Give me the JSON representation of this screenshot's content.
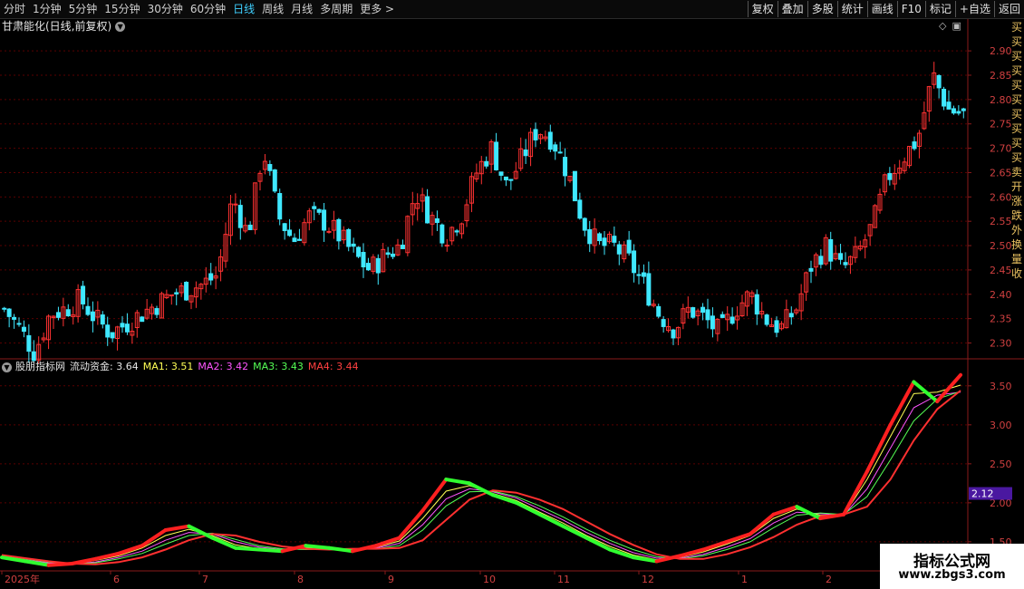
{
  "toolbar": {
    "periods": [
      "分时",
      "1分钟",
      "5分钟",
      "15分钟",
      "30分钟",
      "60分钟",
      "日线",
      "周线",
      "月线",
      "多周期",
      "更多 >"
    ],
    "active_period": "日线",
    "tools": [
      "复权",
      "叠加",
      "多股",
      "统计",
      "画线",
      "F10",
      "标记",
      "+自选",
      "返回"
    ]
  },
  "main_chart": {
    "title": "甘肃能化(日线,前复权)",
    "price_axis": [
      "2.90",
      "2.85",
      "2.80",
      "2.75",
      "2.70",
      "2.65",
      "2.60",
      "2.55",
      "2.50",
      "2.45",
      "2.40",
      "2.35",
      "2.30"
    ],
    "colors": {
      "up": "#ff3232",
      "down": "#3fe8ff",
      "grid": "#5a0000",
      "axis": "#8a1a1a",
      "label": "#d04040"
    }
  },
  "indicator": {
    "name": "股朋指标网",
    "fields": [
      {
        "label": "流动资金:",
        "value": "3.64",
        "color": "#e6e6e6"
      },
      {
        "label": "MA1:",
        "value": "3.51",
        "color": "#ffff55"
      },
      {
        "label": "MA2:",
        "value": "3.42",
        "color": "#ff55ff"
      },
      {
        "label": "MA3:",
        "value": "3.43",
        "color": "#55ff55"
      },
      {
        "label": "MA4:",
        "value": "3.44",
        "color": "#ff4040"
      }
    ],
    "axis": [
      "3.50",
      "3.00",
      "2.50",
      "2.00",
      "1.50"
    ],
    "marker_value": "2.12"
  },
  "date_axis": [
    "2025年",
    "6",
    "7",
    "8",
    "9",
    "10",
    "11",
    "12",
    "1",
    "2"
  ],
  "right_strip_text": "买买买买买买买买买买卖开涨跌外换量收",
  "watermark": {
    "line1": "指标公式网",
    "line2": "www.zbgs3.com"
  },
  "chart_data": {
    "type": "candlestick",
    "title": "甘肃能化(日线,前复权)",
    "ylim": [
      2.26,
      2.93
    ],
    "y_ticks": [
      2.9,
      2.85,
      2.8,
      2.75,
      2.7,
      2.65,
      2.6,
      2.55,
      2.5,
      2.45,
      2.4,
      2.35,
      2.3
    ],
    "months": [
      "2025年",
      "6",
      "7",
      "8",
      "9",
      "10",
      "11",
      "12",
      "1",
      "2"
    ],
    "close_path": [
      2.37,
      2.33,
      2.28,
      2.36,
      2.37,
      2.39,
      2.35,
      2.32,
      2.34,
      2.36,
      2.38,
      2.4,
      2.41,
      2.42,
      2.44,
      2.6,
      2.52,
      2.7,
      2.56,
      2.51,
      2.56,
      2.55,
      2.52,
      2.48,
      2.45,
      2.48,
      2.5,
      2.61,
      2.56,
      2.52,
      2.56,
      2.65,
      2.7,
      2.62,
      2.68,
      2.74,
      2.72,
      2.65,
      2.55,
      2.5,
      2.5,
      2.47,
      2.42,
      2.36,
      2.33,
      2.37,
      2.35,
      2.32,
      2.37,
      2.4,
      2.35,
      2.33,
      2.37,
      2.46,
      2.5,
      2.45,
      2.48,
      2.54,
      2.64,
      2.68,
      2.72,
      2.85,
      2.78,
      2.77
    ],
    "indicator": {
      "ylim": [
        1.15,
        3.8
      ],
      "series": [
        {
          "name": "流动资金",
          "values": [
            1.3,
            1.25,
            1.2,
            1.22,
            1.28,
            1.35,
            1.45,
            1.65,
            1.7,
            1.55,
            1.42,
            1.4,
            1.38,
            1.45,
            1.42,
            1.38,
            1.45,
            1.55,
            1.9,
            2.3,
            2.25,
            2.1,
            2.0,
            1.85,
            1.7,
            1.55,
            1.4,
            1.3,
            1.25,
            1.32,
            1.4,
            1.5,
            1.6,
            1.85,
            1.95,
            1.8,
            1.85,
            2.4,
            3.0,
            3.55,
            3.3,
            3.64
          ]
        },
        {
          "name": "MA1",
          "values": [
            1.3,
            1.26,
            1.22,
            1.22,
            1.26,
            1.32,
            1.42,
            1.58,
            1.66,
            1.58,
            1.46,
            1.41,
            1.39,
            1.42,
            1.42,
            1.4,
            1.43,
            1.51,
            1.8,
            2.15,
            2.22,
            2.12,
            2.03,
            1.88,
            1.74,
            1.58,
            1.44,
            1.33,
            1.27,
            1.3,
            1.37,
            1.47,
            1.58,
            1.8,
            1.92,
            1.84,
            1.84,
            2.3,
            2.85,
            3.4,
            3.42,
            3.51
          ]
        },
        {
          "name": "MA2",
          "values": [
            1.31,
            1.27,
            1.23,
            1.22,
            1.24,
            1.3,
            1.38,
            1.52,
            1.62,
            1.6,
            1.5,
            1.43,
            1.4,
            1.41,
            1.41,
            1.4,
            1.42,
            1.48,
            1.72,
            2.05,
            2.18,
            2.14,
            2.06,
            1.92,
            1.78,
            1.62,
            1.48,
            1.36,
            1.29,
            1.29,
            1.34,
            1.43,
            1.54,
            1.74,
            1.88,
            1.86,
            1.84,
            2.18,
            2.7,
            3.22,
            3.38,
            3.42
          ]
        },
        {
          "name": "MA3",
          "values": [
            1.32,
            1.28,
            1.24,
            1.22,
            1.23,
            1.28,
            1.35,
            1.47,
            1.58,
            1.61,
            1.53,
            1.45,
            1.41,
            1.4,
            1.41,
            1.41,
            1.41,
            1.45,
            1.65,
            1.96,
            2.14,
            2.15,
            2.08,
            1.96,
            1.82,
            1.66,
            1.52,
            1.4,
            1.31,
            1.28,
            1.32,
            1.4,
            1.5,
            1.68,
            1.84,
            1.87,
            1.85,
            2.08,
            2.55,
            3.05,
            3.33,
            3.43
          ]
        },
        {
          "name": "MA4",
          "values": [
            1.33,
            1.29,
            1.25,
            1.22,
            1.21,
            1.24,
            1.3,
            1.4,
            1.52,
            1.6,
            1.58,
            1.5,
            1.44,
            1.41,
            1.4,
            1.41,
            1.41,
            1.42,
            1.52,
            1.78,
            2.04,
            2.16,
            2.13,
            2.04,
            1.92,
            1.76,
            1.6,
            1.46,
            1.34,
            1.28,
            1.28,
            1.34,
            1.43,
            1.56,
            1.72,
            1.83,
            1.85,
            1.95,
            2.3,
            2.8,
            3.2,
            3.44
          ]
        }
      ]
    }
  }
}
